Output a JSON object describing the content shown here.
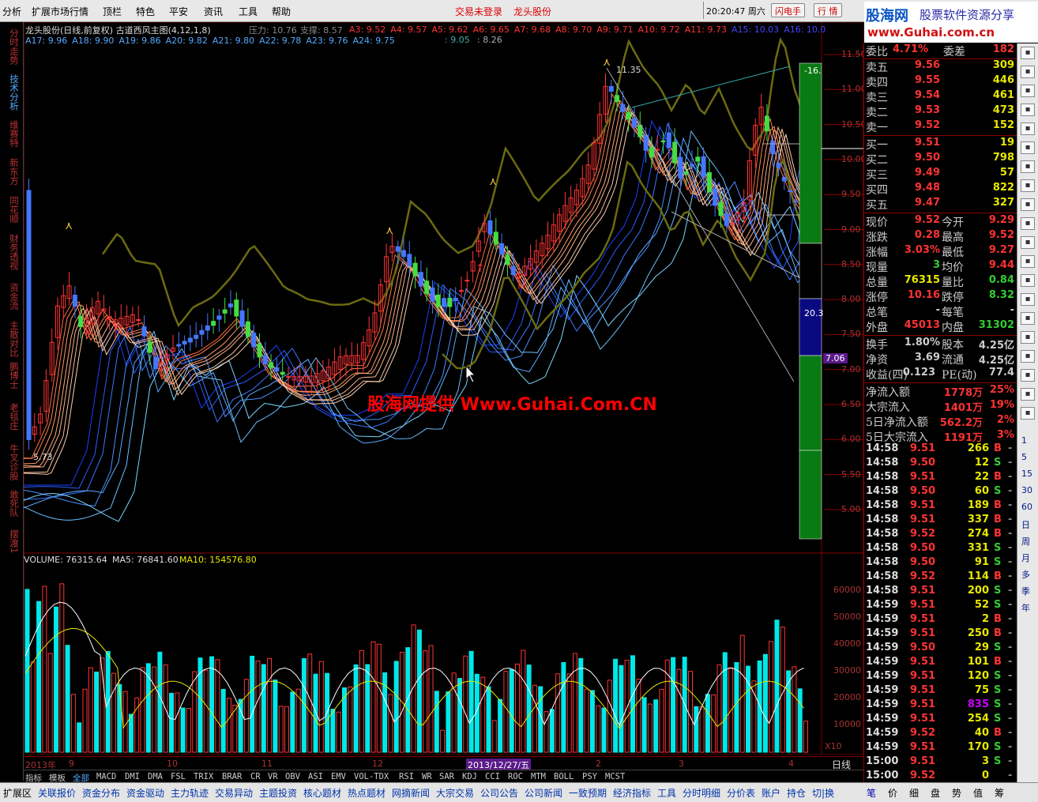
{
  "menu": {
    "items": [
      "分析",
      "扩展市场行情",
      "资讯",
      "顶栏",
      "特色",
      "平安",
      "资讯",
      "工具",
      "帮助"
    ],
    "status_not_logged": "交易未登录",
    "stock_short": "龙头股份",
    "clock": "20:20:47 周六",
    "btn_flash": "闪电手",
    "btn_quote": "行  情"
  },
  "brand": {
    "logo": "股海网",
    "slogan": "股票软件资源分享",
    "url": "www.Guhai.com.cn"
  },
  "left_tabs": [
    "分时走势",
    "技术分析",
    "维赛特",
    "新东方",
    "同花顺",
    "财务透视",
    "资金流",
    "主散对比",
    "鹏博士",
    "老毯庄",
    "牛叉诊股",
    "敢死队",
    "摆渡1"
  ],
  "main_chart": {
    "title": "龙头股份(日线,前复权) 古道西风主图(4,12,1,8)",
    "pressure": "压力: 10.76",
    "support": "支撑: 8.57",
    "ma_line1": [
      "A3: 9.52",
      "A4: 9.57",
      "A5: 9.62",
      "A6: 9.65",
      "A7: 9.68",
      "A8: 9.70",
      "A9: 9.71",
      "A10: 9.72",
      "A11: 9.73",
      "A15: 10.03",
      "A16: 10.0"
    ],
    "ma_line2": [
      "A17: 9.96",
      "A18: 9.90",
      "A19: 9.86",
      "A20: 9.82",
      "A21: 9.80",
      "A22: 9.78",
      "A23: 9.76",
      "A24: 9.75"
    ],
    "extra1": ": 9.05",
    "extra2": ": 8.26",
    "watermark": "股海网提供 Www.Guhai.Com.CN",
    "high_label": "11.35",
    "low_label": "5.73",
    "y_axis": [
      "11.50",
      "11.00",
      "10.50",
      "10.00",
      "9.50",
      "9.00",
      "8.50",
      "8.00",
      "7.50",
      "7.00",
      "6.50",
      "6.00",
      "5.50",
      "5.00"
    ],
    "bar_top_label": "-16.",
    "bar_mid_label": "20.3",
    "current_marker": "7.06"
  },
  "volume_chart": {
    "title_vol": "VOLUME: 76315.64",
    "title_ma5": "MA5: 76841.60",
    "title_ma10": "MA10: 154576.80",
    "y_axis": [
      "60000",
      "50000",
      "40000",
      "30000",
      "20000",
      "10000"
    ],
    "unit": "X10"
  },
  "date_axis": {
    "labels": [
      "2013年",
      "9",
      "10",
      "11",
      "12",
      "2013/12/27/五",
      "2",
      "3",
      "4"
    ],
    "period": "日线"
  },
  "quote": {
    "weibi_label": "委比",
    "weibi_val": "4.71%",
    "weicha_label": "委差",
    "weicha_val": "182",
    "asks": [
      {
        "label": "卖五",
        "price": "9.56",
        "vol": "309"
      },
      {
        "label": "卖四",
        "price": "9.55",
        "vol": "446"
      },
      {
        "label": "卖三",
        "price": "9.54",
        "vol": "461"
      },
      {
        "label": "卖二",
        "price": "9.53",
        "vol": "473"
      },
      {
        "label": "卖一",
        "price": "9.52",
        "vol": "152"
      }
    ],
    "bids": [
      {
        "label": "买一",
        "price": "9.51",
        "vol": "19"
      },
      {
        "label": "买二",
        "price": "9.50",
        "vol": "798"
      },
      {
        "label": "买三",
        "price": "9.49",
        "vol": "57"
      },
      {
        "label": "买四",
        "price": "9.48",
        "vol": "822"
      },
      {
        "label": "买五",
        "price": "9.47",
        "vol": "327"
      }
    ],
    "stats": [
      {
        "l1": "现价",
        "v1": "9.52",
        "c1": "#f33",
        "l2": "今开",
        "v2": "9.29",
        "c2": "#f33"
      },
      {
        "l1": "涨跌",
        "v1": "0.28",
        "c1": "#f33",
        "l2": "最高",
        "v2": "9.52",
        "c2": "#f33"
      },
      {
        "l1": "涨幅",
        "v1": "3.03%",
        "c1": "#f33",
        "l2": "最低",
        "v2": "9.27",
        "c2": "#f33"
      },
      {
        "l1": "现量",
        "v1": "3",
        "c1": "#3c3",
        "l2": "均价",
        "v2": "9.44",
        "c2": "#f33"
      },
      {
        "l1": "总量",
        "v1": "76315",
        "c1": "#e8e800",
        "l2": "量比",
        "v2": "0.84",
        "c2": "#3c3"
      },
      {
        "l1": "涨停",
        "v1": "10.16",
        "c1": "#f33",
        "l2": "跌停",
        "v2": "8.32",
        "c2": "#3c3"
      },
      {
        "l1": "总笔",
        "v1": "-",
        "c1": "#ccc",
        "l2": "每笔",
        "v2": "-",
        "c2": "#ccc"
      },
      {
        "l1": "外盘",
        "v1": "45013",
        "c1": "#f33",
        "l2": "内盘",
        "v2": "31302",
        "c2": "#3c3"
      }
    ],
    "stats2": [
      {
        "l1": "换手",
        "v1": "1.80%",
        "c1": "#ccc",
        "l2": "股本",
        "v2": "4.25亿",
        "c2": "#ccc"
      },
      {
        "l1": "净资",
        "v1": "3.69",
        "c1": "#ccc",
        "l2": "流通",
        "v2": "4.25亿",
        "c2": "#ccc"
      },
      {
        "l1": "收益(四)",
        "v1": "0.123",
        "c1": "#ccc",
        "l2": "PE(动)",
        "v2": "77.4",
        "c2": "#ccc"
      }
    ],
    "flows": [
      {
        "label": "净流入额",
        "val": "1778万",
        "pct": "25%"
      },
      {
        "label": "大宗流入",
        "val": "1401万",
        "pct": "19%"
      },
      {
        "label": "5日净流入额",
        "val": "562.2万",
        "pct": "2%"
      },
      {
        "label": "5日大宗流入",
        "val": "1191万",
        "pct": "3%"
      }
    ]
  },
  "ticks": [
    {
      "t": "14:58",
      "p": "9.51",
      "v": "266",
      "s": "B"
    },
    {
      "t": "14:58",
      "p": "9.50",
      "v": "12",
      "s": "S"
    },
    {
      "t": "14:58",
      "p": "9.51",
      "v": "22",
      "s": "B"
    },
    {
      "t": "14:58",
      "p": "9.50",
      "v": "60",
      "s": "S"
    },
    {
      "t": "14:58",
      "p": "9.51",
      "v": "189",
      "s": "B"
    },
    {
      "t": "14:58",
      "p": "9.51",
      "v": "337",
      "s": "B"
    },
    {
      "t": "14:58",
      "p": "9.52",
      "v": "274",
      "s": "B"
    },
    {
      "t": "14:58",
      "p": "9.50",
      "v": "331",
      "s": "S"
    },
    {
      "t": "14:58",
      "p": "9.50",
      "v": "91",
      "s": "S"
    },
    {
      "t": "14:58",
      "p": "9.52",
      "v": "114",
      "s": "B"
    },
    {
      "t": "14:58",
      "p": "9.51",
      "v": "200",
      "s": "S"
    },
    {
      "t": "14:59",
      "p": "9.51",
      "v": "52",
      "s": "S"
    },
    {
      "t": "14:59",
      "p": "9.51",
      "v": "2",
      "s": "B"
    },
    {
      "t": "14:59",
      "p": "9.51",
      "v": "250",
      "s": "B"
    },
    {
      "t": "14:59",
      "p": "9.50",
      "v": "29",
      "s": "S"
    },
    {
      "t": "14:59",
      "p": "9.51",
      "v": "101",
      "s": "B"
    },
    {
      "t": "14:59",
      "p": "9.51",
      "v": "120",
      "s": "S"
    },
    {
      "t": "14:59",
      "p": "9.51",
      "v": "75",
      "s": "S"
    },
    {
      "t": "14:59",
      "p": "9.51",
      "v": "835",
      "s": "S"
    },
    {
      "t": "14:59",
      "p": "9.51",
      "v": "254",
      "s": "S"
    },
    {
      "t": "14:59",
      "p": "9.52",
      "v": "40",
      "s": "B"
    },
    {
      "t": "14:59",
      "p": "9.51",
      "v": "170",
      "s": "S"
    },
    {
      "t": "15:00",
      "p": "9.51",
      "v": "3",
      "s": "S"
    },
    {
      "t": "15:00",
      "p": "9.52",
      "v": "0",
      "s": ""
    }
  ],
  "indicator_tabs": [
    "指标",
    "模板",
    "全部",
    "MACD",
    "DMI",
    "DMA",
    "FSL",
    "TRIX",
    "BRAR",
    "CR",
    "VR",
    "OBV",
    "ASI",
    "EMV",
    "VOL-TDX",
    "RSI",
    "WR",
    "SAR",
    "KDJ",
    "CCI",
    "ROC",
    "MTM",
    "BOLL",
    "PSY",
    "MCST"
  ],
  "bottom_tabs": [
    "扩展区",
    "关联报价",
    "资金分布",
    "资金驱动",
    "主力轨迹",
    "交易异动",
    "主题投资",
    "核心题材",
    "热点题材",
    "网摘新闻",
    "大宗交易",
    "公司公告",
    "公司新闻",
    "一致预期",
    "经济指标",
    "工具",
    "分时明细",
    "分价表",
    "账户",
    "持仓",
    "切|换"
  ],
  "bottom_right_tabs": [
    "笔",
    "价",
    "细",
    "盘",
    "势",
    "值",
    "筹"
  ],
  "icon_col_labels": [
    "1",
    "5",
    "15",
    "30",
    "60",
    "日",
    "周",
    "月",
    "多",
    "季",
    "年"
  ],
  "colors": {
    "up": "#ff3333",
    "down": "#00e8e8",
    "bg": "#000000",
    "grid": "#800000"
  }
}
